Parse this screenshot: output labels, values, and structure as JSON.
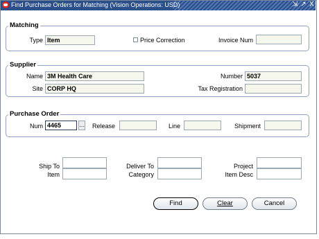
{
  "window": {
    "title": "Find Purchase Orders for Matching (Vision Operations: USD)",
    "controls": [
      "⇲",
      "↗",
      "X"
    ]
  },
  "matching": {
    "group_title": "Matching",
    "type_label": "Type",
    "type_value": "Item",
    "price_correction_label": "Price Correction",
    "price_correction_checked": false,
    "invoice_num_label": "Invoice Num",
    "invoice_num_value": ""
  },
  "supplier": {
    "group_title": "Supplier",
    "name_label": "Name",
    "name_value": "3M Health Care",
    "site_label": "Site",
    "site_value": "CORP HQ",
    "number_label": "Number",
    "number_value": "5037",
    "tax_registration_label": "Tax Registration",
    "tax_registration_value": ""
  },
  "purchase_order": {
    "group_title": "Purchase Order",
    "num_label": "Num",
    "num_value": "4465",
    "lov_label": "...",
    "release_label": "Release",
    "release_value": "",
    "line_label": "Line",
    "line_value": "",
    "shipment_label": "Shipment",
    "shipment_value": ""
  },
  "filters": {
    "ship_to_label": "Ship To",
    "ship_to_value": "",
    "deliver_to_label": "Deliver To",
    "deliver_to_value": "",
    "project_label": "Project",
    "project_value": "",
    "item_label": "Item",
    "item_value": "",
    "category_label": "Category",
    "category_value": "",
    "item_desc_label": "Item Desc",
    "item_desc_value": ""
  },
  "buttons": {
    "find": "Find",
    "clear": "Clear",
    "cancel": "Cancel"
  },
  "colors": {
    "title_bar": "#2b4f8a",
    "group_border": "#8ea3c1",
    "readonly_field": "#f5f7ec"
  }
}
